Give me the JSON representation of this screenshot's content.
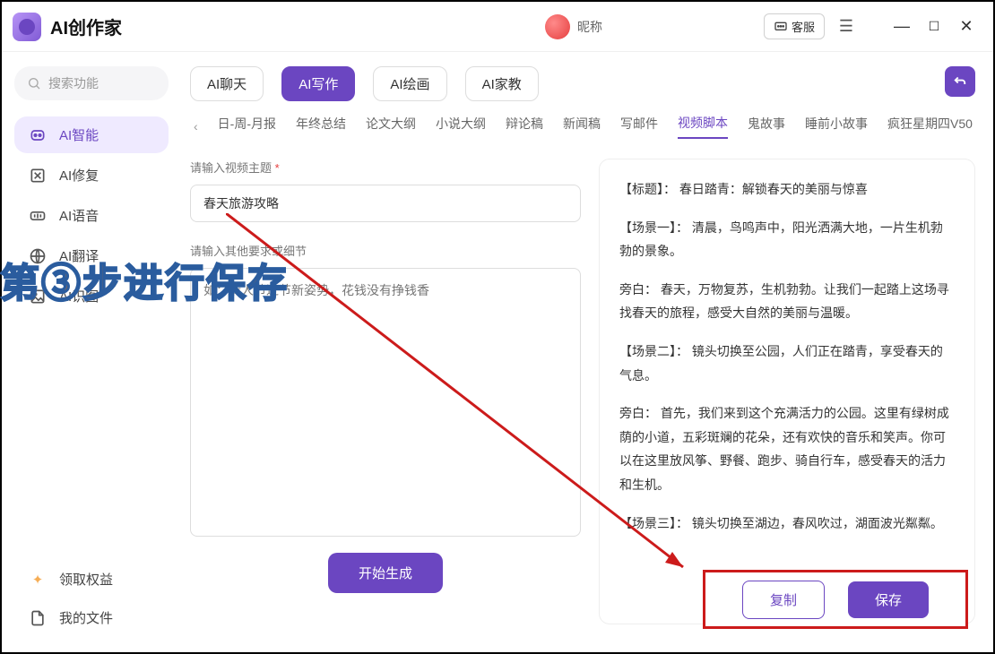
{
  "app": {
    "title": "AI创作家"
  },
  "titlebar": {
    "nickname": "昵称",
    "support": "客服"
  },
  "sidebar": {
    "search_placeholder": "搜索功能",
    "items": [
      {
        "label": "AI智能"
      },
      {
        "label": "AI修复"
      },
      {
        "label": "AI语音"
      },
      {
        "label": "AI翻译"
      },
      {
        "label": "AI识图"
      }
    ],
    "bottom": [
      {
        "label": "领取权益"
      },
      {
        "label": "我的文件"
      }
    ]
  },
  "tabs": [
    {
      "label": "AI聊天"
    },
    {
      "label": "AI写作"
    },
    {
      "label": "AI绘画"
    },
    {
      "label": "AI家教"
    }
  ],
  "subtabs": [
    "日-周-月报",
    "年终总结",
    "论文大纲",
    "小说大纲",
    "辩论稿",
    "新闻稿",
    "写邮件",
    "视频脚本",
    "鬼故事",
    "睡前小故事",
    "疯狂星期四V50"
  ],
  "subtabs_active_index": 7,
  "form": {
    "topic_label": "请输入视频主题",
    "topic_value": "春天旅游攻略",
    "detail_label": "请输入其他要求或细节",
    "detail_placeholder": "如：情人节过节新姿势，花钱没有挣钱香",
    "generate": "开始生成"
  },
  "output": {
    "p1": "【标题】： 春日踏青：解锁春天的美丽与惊喜",
    "p2": "【场景一】： 清晨，鸟鸣声中，阳光洒满大地，一片生机勃勃的景象。",
    "p3": "旁白： 春天，万物复苏，生机勃勃。让我们一起踏上这场寻找春天的旅程，感受大自然的美丽与温暖。",
    "p4": "【场景二】： 镜头切换至公园，人们正在踏青，享受春天的气息。",
    "p5": "旁白： 首先，我们来到这个充满活力的公园。这里有绿树成荫的小道，五彩斑斓的花朵，还有欢快的音乐和笑声。你可以在这里放风筝、野餐、跑步、骑自行车，感受春天的活力和生机。",
    "p6": "【场景三】： 镜头切换至湖边，春风吹过，湖面波光粼粼。"
  },
  "actions": {
    "copy": "复制",
    "save": "保存"
  },
  "annotation": "第③步进行保存"
}
